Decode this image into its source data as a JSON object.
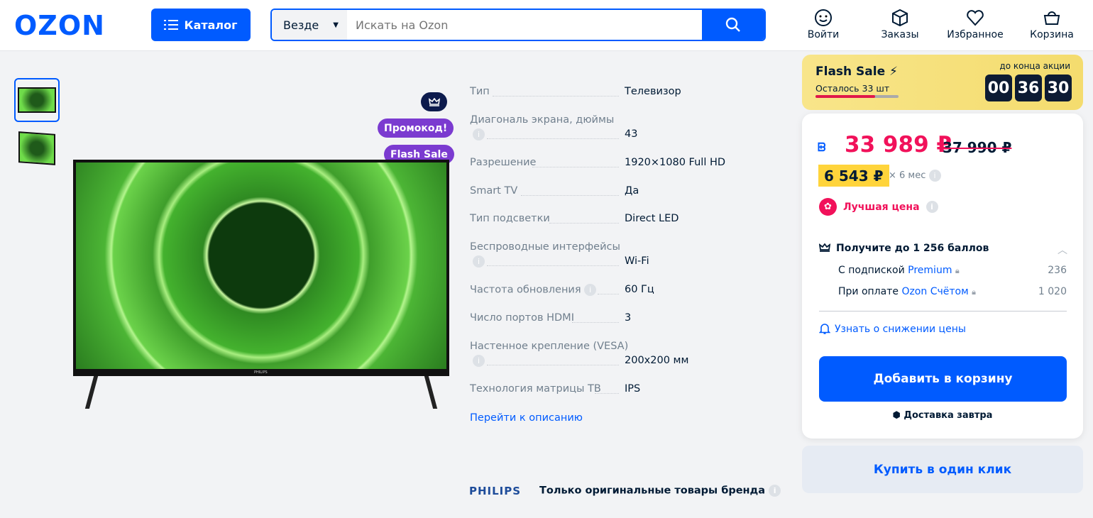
{
  "header": {
    "logo": "OZON",
    "catalog_label": "Каталог",
    "search_scope": "Везде",
    "search_placeholder": "Искать на Ozon",
    "actions": [
      {
        "label": "Войти",
        "icon": "face-icon"
      },
      {
        "label": "Заказы",
        "icon": "box-icon"
      },
      {
        "label": "Избранное",
        "icon": "heart-icon"
      },
      {
        "label": "Корзина",
        "icon": "basket-icon"
      }
    ]
  },
  "gallery": {
    "badges": {
      "promo": "Промокод!",
      "flash": "Flash Sale"
    },
    "tv_brand": "PHILIPS"
  },
  "specs": [
    {
      "label": "Тип",
      "value": "Телевизор"
    },
    {
      "label": "Диагональ экрана, дюймы",
      "value": "43",
      "info": true
    },
    {
      "label": "Разрешение",
      "value": "1920×1080 Full HD"
    },
    {
      "label": "Smart TV",
      "value": "Да",
      "link": true
    },
    {
      "label": "Тип подсветки",
      "value": "Direct LED"
    },
    {
      "label": "Беспроводные интерфейсы",
      "value": "Wi-Fi",
      "info": true,
      "link": true
    },
    {
      "label": "Частота обновления",
      "value": "60 Гц",
      "inline_info": true
    },
    {
      "label": "Число портов HDMI",
      "value": "3"
    },
    {
      "label": "Настенное крепление (VESA)",
      "value": "200x200 мм",
      "info": true
    },
    {
      "label": "Технология матрицы ТВ",
      "value": "IPS"
    }
  ],
  "description_link": "Перейти к описанию",
  "brand": {
    "name": "PHILIPS",
    "text": "Только оригинальные товары бренда"
  },
  "flash_sale": {
    "title": "Flash Sale",
    "remaining": "Осталось 33 шт",
    "remaining_progress": 0.72,
    "timer_label": "до конца акции",
    "timer": [
      "00",
      "36",
      "30"
    ]
  },
  "price": {
    "current": "33 989 ₽",
    "old": "37 990 ₽",
    "installment": "6 543 ₽",
    "installment_term": "× 6 мес",
    "best_price": "Лучшая цена",
    "colors": {
      "price": "#f1115a",
      "installment_bg": "#ffd43b"
    }
  },
  "points": {
    "title": "Получите до 1 256 баллов",
    "rows": [
      {
        "prefix": "С подпиской",
        "link": "Premium",
        "value": "236"
      },
      {
        "prefix": "При оплате",
        "link": "Ozon Счётом",
        "value": "1 020"
      }
    ]
  },
  "price_alert": "Узнать о снижении цены",
  "add_to_cart": "Добавить в корзину",
  "delivery": "Доставка завтра",
  "buy_one_click": "Купить в один клик",
  "colors": {
    "accent": "#005bff"
  }
}
